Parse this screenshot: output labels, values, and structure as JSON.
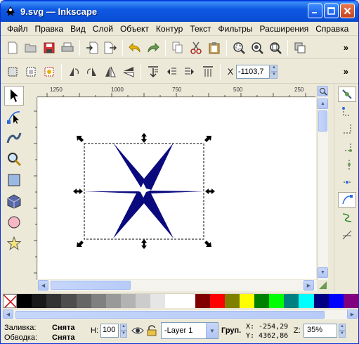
{
  "window": {
    "title": "9.svg — Inkscape"
  },
  "menu": [
    "Файл",
    "Правка",
    "Вид",
    "Слой",
    "Объект",
    "Контур",
    "Текст",
    "Фильтры",
    "Расширения",
    "Справка"
  ],
  "toolbar1_more": "»",
  "toolbar2": {
    "x_label": "X",
    "x_value": "-1103,7",
    "more": "»"
  },
  "ruler": {
    "top_labels": [
      "1250",
      "1000",
      "750",
      "500",
      "250"
    ]
  },
  "palette": {
    "colors": [
      "#000000",
      "#1a1a1a",
      "#333333",
      "#4d4d4d",
      "#666666",
      "#808080",
      "#999999",
      "#b3b3b3",
      "#cccccc",
      "#e6e6e6",
      "#ffffff",
      "#ffffff",
      "#800000",
      "#ff0000",
      "#808000",
      "#ffff00",
      "#008000",
      "#00ff00",
      "#008080",
      "#00ffff",
      "#000080",
      "#0000ff",
      "#800080"
    ]
  },
  "status": {
    "fill_label": "Заливка:",
    "fill_value": "Снята",
    "stroke_label": "Обводка:",
    "stroke_value": "Снята",
    "h_label": "H:",
    "h_value": "100",
    "layer": "-Layer 1",
    "group_label": "Груп.",
    "x_coord": "X: -254,29",
    "y_coord": "Y: 4362,86",
    "zoom_label": "Z:",
    "zoom_value": "35%"
  },
  "colors": {
    "star": "#0a0a7e",
    "titlebar": "#0a4fd6"
  }
}
